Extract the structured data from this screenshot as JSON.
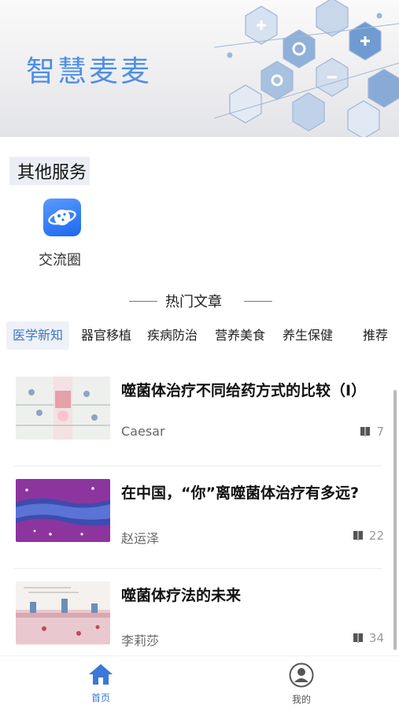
{
  "banner": {
    "title": "智慧麦麦"
  },
  "services": {
    "title": "其他服务",
    "items": [
      {
        "label": "交流圈",
        "icon": "planet-icon"
      }
    ]
  },
  "hot_articles": {
    "title": "热门文章",
    "tabs": [
      "医学新知",
      "器官移植",
      "疾病防治",
      "营养美食",
      "养生保健",
      "推荐"
    ],
    "active_tab": "医学新知"
  },
  "articles": [
    {
      "title": "噬菌体治疗不同给药方式的比较（Ⅰ）",
      "author": "Caesar",
      "reads": "7"
    },
    {
      "title": "在中国，“你”离噬菌体治疗有多远?",
      "author": "赵运泽",
      "reads": "22"
    },
    {
      "title": "噬菌体疗法的未来",
      "author": "李莉莎",
      "reads": "34"
    }
  ],
  "bottom_nav": {
    "home": {
      "label": "首页",
      "icon": "home-icon"
    },
    "mine": {
      "label": "我的",
      "icon": "user-icon"
    }
  },
  "colors": {
    "accent": "#3b78d8",
    "banner_title": "#4d8fe6",
    "service_icon": "#2a74f0"
  }
}
